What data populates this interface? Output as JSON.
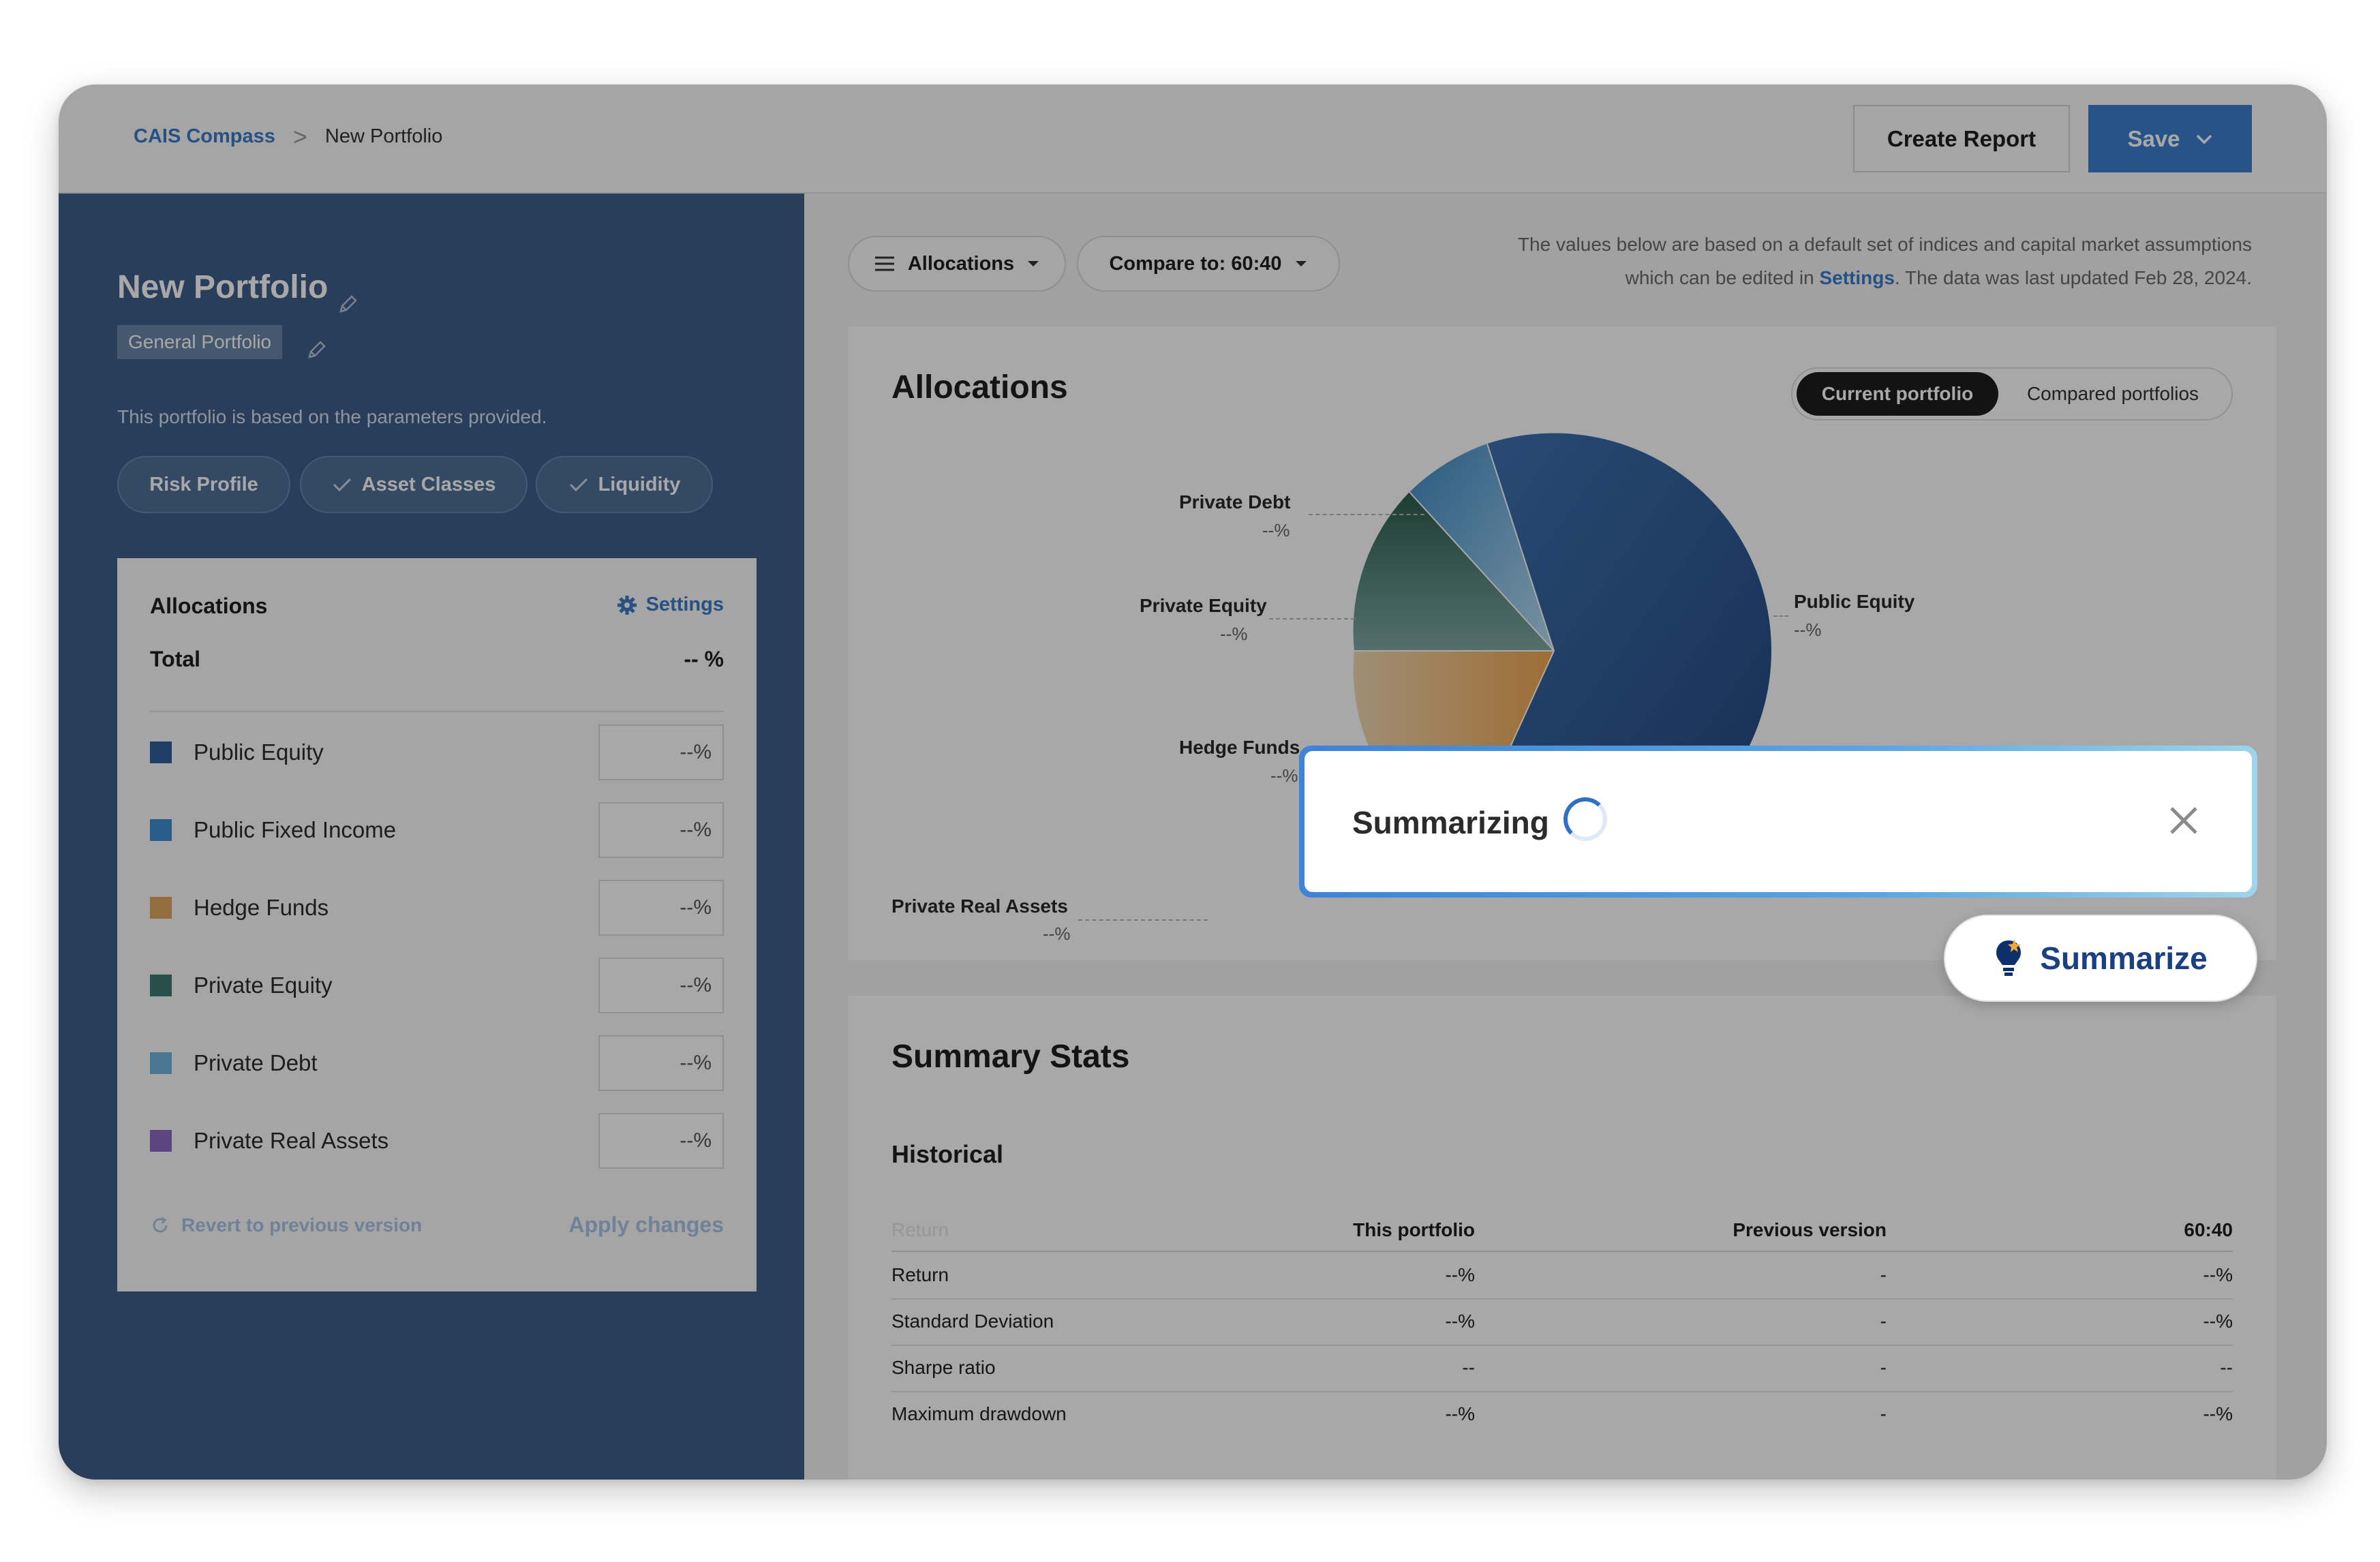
{
  "breadcrumb": {
    "root": "CAIS Compass",
    "separator": ">",
    "current": "New Portfolio"
  },
  "header": {
    "create_report": "Create Report",
    "save": "Save"
  },
  "left": {
    "title": "New Portfolio",
    "tag": "General Portfolio",
    "note": "This portfolio is based on the parameters provided.",
    "pills": {
      "risk": "Risk Profile",
      "asset_classes": "Asset Classes",
      "liquidity": "Liquidity"
    },
    "card": {
      "title": "Allocations",
      "settings": "Settings",
      "total_label": "Total",
      "total_value": "-- %",
      "assets": [
        {
          "name": "Public Equity",
          "value": "--%",
          "color": "#2f5f9b"
        },
        {
          "name": "Public Fixed Income",
          "value": "--%",
          "color": "#3f8dd2"
        },
        {
          "name": "Hedge Funds",
          "value": "--%",
          "color": "#e3a862"
        },
        {
          "name": "Private Equity",
          "value": "--%",
          "color": "#3b7a70"
        },
        {
          "name": "Private Debt",
          "value": "--%",
          "color": "#6fb3dc"
        },
        {
          "name": "Private Real Assets",
          "value": "--%",
          "color": "#8c6bc4"
        }
      ],
      "revert": "Revert to previous version",
      "apply": "Apply changes"
    }
  },
  "right": {
    "filters": {
      "allocations": "Allocations",
      "compare": "Compare to: 60:40"
    },
    "disclaimer": {
      "line1": "The values below are based on a default set of indices and capital market assumptions",
      "line2_pre": "which can be edited in ",
      "line2_link": "Settings",
      "line2_post": ". The data was last updated Feb 28, 2024."
    },
    "alloc_panel": {
      "title": "Allocations",
      "toggle_active": "Current portfolio",
      "toggle_inactive": "Compared portfolios",
      "labels": {
        "private_debt": "Private Debt",
        "private_debt_pct": "--%",
        "private_equity": "Private Equity",
        "private_equity_pct": "--%",
        "hedge_funds": "Hedge Funds",
        "hedge_funds_pct": "--%",
        "public_equity": "Public Equity",
        "public_equity_pct": "--%",
        "private_real_assets": "Private Real Assets",
        "private_real_assets_pct": "--%"
      }
    },
    "stats": {
      "title": "Summary Stats",
      "subtitle": "Historical",
      "columns": [
        "Return",
        "This portfolio",
        "Previous version",
        "60:40"
      ],
      "rows": [
        {
          "label": "Return",
          "this": "--%",
          "prev": "-",
          "bench": "--%"
        },
        {
          "label": "Standard Deviation",
          "this": "--%",
          "prev": "-",
          "bench": "--%"
        },
        {
          "label": "Sharpe ratio",
          "this": "--",
          "prev": "-",
          "bench": "--"
        },
        {
          "label": "Maximum drawdown",
          "this": "--%",
          "prev": "-",
          "bench": "--%"
        }
      ]
    }
  },
  "overlay": {
    "status": "Summarizing",
    "summarize_button": "Summarize"
  }
}
